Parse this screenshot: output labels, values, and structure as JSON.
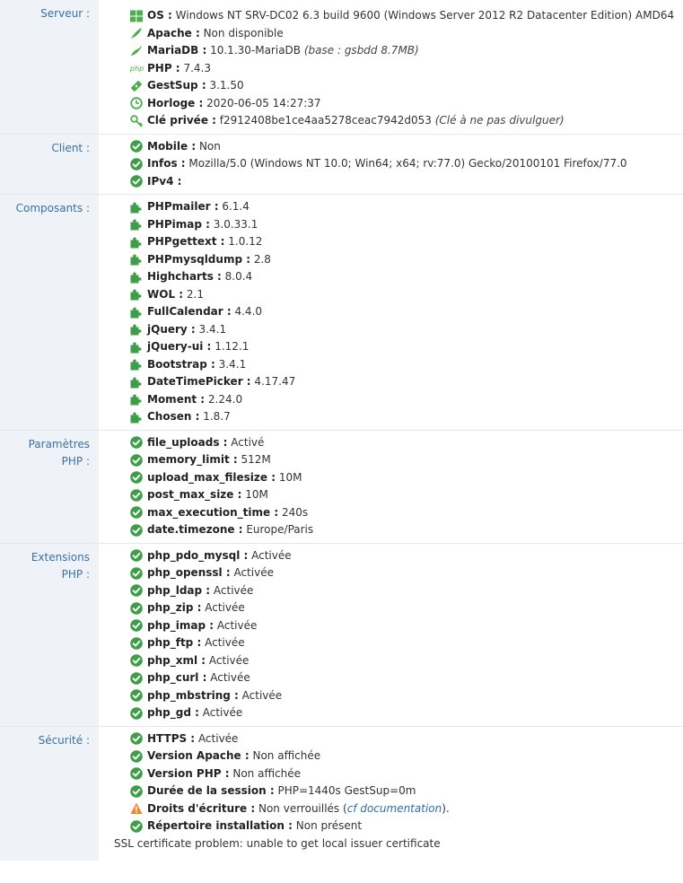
{
  "serveur": {
    "label": "Serveur :",
    "rows": [
      {
        "icon": "windows-icon",
        "key": "OS :",
        "val": "Windows NT SRV-DC02 6.3 build 9600 (Windows Server 2012 R2 Datacenter Edition) AMD64",
        "extra": ""
      },
      {
        "icon": "apache-feather-icon",
        "key": "Apache :",
        "val": "Non disponible",
        "extra": ""
      },
      {
        "icon": "mariadb-seal-icon",
        "key": "MariaDB :",
        "val": "10.1.30-MariaDB",
        "extra": "(base : gsbdd 8.7MB)"
      },
      {
        "icon": "php-logo-icon",
        "key": "PHP :",
        "val": "7.4.3",
        "extra": ""
      },
      {
        "icon": "ticket-icon",
        "key": "GestSup :",
        "val": "3.1.50",
        "extra": ""
      },
      {
        "icon": "clock-icon",
        "key": "Horloge :",
        "val": "2020-06-05 14:27:37",
        "extra": ""
      },
      {
        "icon": "key-icon",
        "key": "Clé privée :",
        "val": "f2912408be1ce4aa5278ceac7942d053",
        "extra": "(Clé à ne pas divulguer)"
      }
    ]
  },
  "client": {
    "label": "Client :",
    "rows": [
      {
        "key": "Mobile :",
        "val": "Non"
      },
      {
        "key": "Infos :",
        "val": "Mozilla/5.0 (Windows NT 10.0; Win64; x64; rv:77.0) Gecko/20100101 Firefox/77.0"
      },
      {
        "key": "IPv4 :",
        "val": ""
      }
    ]
  },
  "composants": {
    "label": "Composants :",
    "rows": [
      {
        "key": "PHPmailer :",
        "val": "6.1.4"
      },
      {
        "key": "PHPimap :",
        "val": "3.0.33.1"
      },
      {
        "key": "PHPgettext :",
        "val": "1.0.12"
      },
      {
        "key": "PHPmysqldump :",
        "val": "2.8"
      },
      {
        "key": "Highcharts :",
        "val": "8.0.4"
      },
      {
        "key": "WOL :",
        "val": "2.1"
      },
      {
        "key": "FullCalendar :",
        "val": "4.4.0"
      },
      {
        "key": "jQuery :",
        "val": "3.4.1"
      },
      {
        "key": "jQuery-ui :",
        "val": "1.12.1"
      },
      {
        "key": "Bootstrap :",
        "val": "3.4.1"
      },
      {
        "key": "DateTimePicker :",
        "val": "4.17.47"
      },
      {
        "key": "Moment :",
        "val": "2.24.0"
      },
      {
        "key": "Chosen :",
        "val": "1.8.7"
      }
    ]
  },
  "params_php": {
    "label_line1": "Paramètres",
    "label_line2": "PHP :",
    "rows": [
      {
        "key": "file_uploads :",
        "val": "Activé"
      },
      {
        "key": "memory_limit :",
        "val": "512M"
      },
      {
        "key": "upload_max_filesize :",
        "val": "10M"
      },
      {
        "key": "post_max_size :",
        "val": "10M"
      },
      {
        "key": "max_execution_time :",
        "val": "240s"
      },
      {
        "key": "date.timezone :",
        "val": "Europe/Paris"
      }
    ]
  },
  "ext_php": {
    "label_line1": "Extensions",
    "label_line2": "PHP :",
    "rows": [
      {
        "key": "php_pdo_mysql :",
        "val": "Activée"
      },
      {
        "key": "php_openssl :",
        "val": "Activée"
      },
      {
        "key": "php_ldap :",
        "val": "Activée"
      },
      {
        "key": "php_zip :",
        "val": "Activée"
      },
      {
        "key": "php_imap :",
        "val": "Activée"
      },
      {
        "key": "php_ftp :",
        "val": "Activée"
      },
      {
        "key": "php_xml :",
        "val": "Activée"
      },
      {
        "key": "php_curl :",
        "val": "Activée"
      },
      {
        "key": "php_mbstring :",
        "val": "Activée"
      },
      {
        "key": "php_gd :",
        "val": "Activée"
      }
    ]
  },
  "securite": {
    "label": "Sécurité :",
    "rows": [
      {
        "icon": "check-circle-icon",
        "key": "HTTPS :",
        "val": "Activée"
      },
      {
        "icon": "check-circle-icon",
        "key": "Version Apache :",
        "val": "Non affichée"
      },
      {
        "icon": "check-circle-icon",
        "key": "Version PHP :",
        "val": "Non affichée"
      },
      {
        "icon": "check-circle-icon",
        "key": "Durée de la session :",
        "val": "PHP=1440s GestSup=0m"
      },
      {
        "icon": "warning-icon",
        "key": "Droits d'écriture :",
        "val": "Non verrouillés",
        "link": "cf documentation",
        "after": ")."
      },
      {
        "icon": "check-circle-icon",
        "key": "Répertoire installation :",
        "val": "Non présent"
      }
    ],
    "ssl_error": "SSL certificate problem: unable to get local issuer certificate"
  },
  "colors": {
    "label": "#3a70a5",
    "label_bg": "#eff3f8",
    "check": "#3e9d48",
    "warning": "#ec8a2b",
    "component": "#3e9d48",
    "link": "#2d6ea8"
  }
}
